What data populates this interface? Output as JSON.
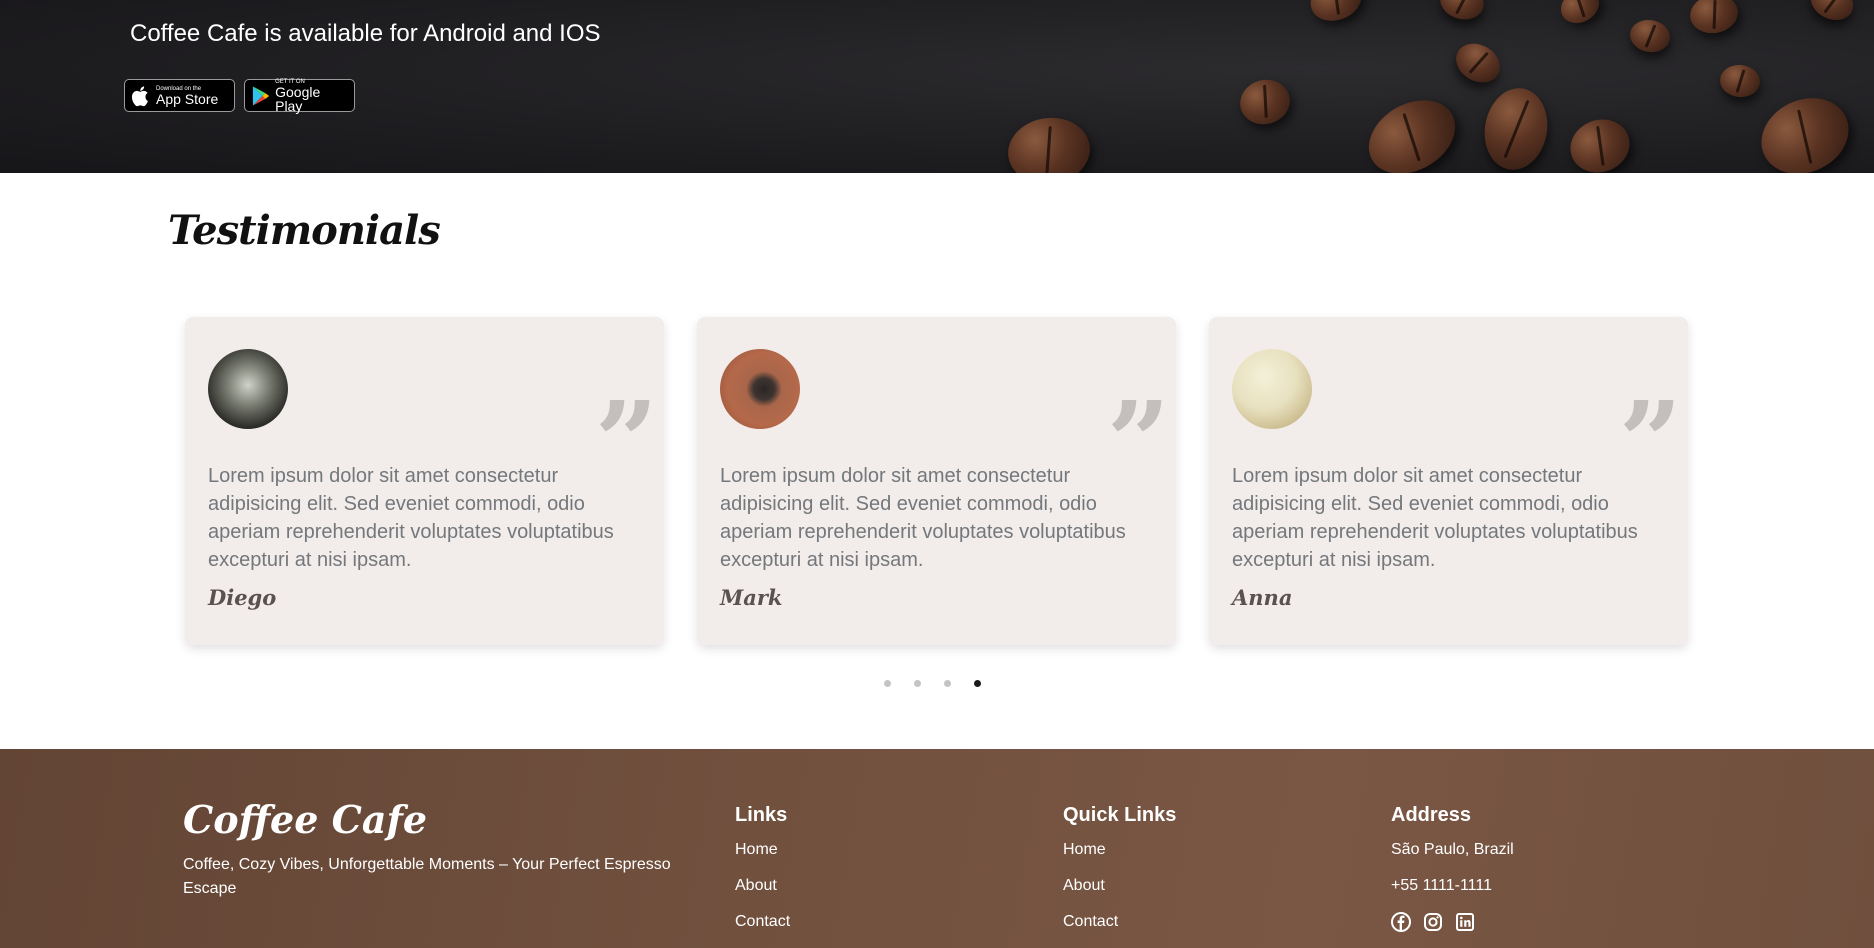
{
  "banner": {
    "title": "Coffee Cafe is available for Android and IOS",
    "app_store": {
      "small": "Download on the",
      "big": "App Store"
    },
    "google_play": {
      "small": "GET IT ON",
      "big": "Google Play"
    }
  },
  "testimonials": {
    "title": "Testimonials",
    "cards": [
      {
        "text": "Lorem ipsum dolor sit amet consectetur adipisicing elit. Sed eveniet commodi, odio aperiam reprehenderit voluptates voluptatibus excepturi at nisi ipsam.",
        "name": "Diego"
      },
      {
        "text": "Lorem ipsum dolor sit amet consectetur adipisicing elit. Sed eveniet commodi, odio aperiam reprehenderit voluptates voluptatibus excepturi at nisi ipsam.",
        "name": "Mark"
      },
      {
        "text": "Lorem ipsum dolor sit amet consectetur adipisicing elit. Sed eveniet commodi, odio aperiam reprehenderit voluptates voluptatibus excepturi at nisi ipsam.",
        "name": "Anna"
      }
    ],
    "pagination": {
      "total": 4,
      "active_index": 3
    }
  },
  "footer": {
    "brand": "Coffee Cafe",
    "tagline": "Coffee, Cozy Vibes, Unforgettable Moments – Your Perfect Espresso Escape",
    "links": {
      "heading": "Links",
      "items": [
        "Home",
        "About",
        "Contact"
      ]
    },
    "quick_links": {
      "heading": "Quick Links",
      "items": [
        "Home",
        "About",
        "Contact"
      ]
    },
    "address": {
      "heading": "Address",
      "city": "São Paulo, Brazil",
      "phone": "+55 1111-1111",
      "socials": [
        "facebook-icon",
        "instagram-icon",
        "linkedin-icon"
      ]
    }
  },
  "colors": {
    "banner_bg": "#1f1e21",
    "card_bg": "#f2ecea",
    "card_text": "#74787c",
    "footer_bg": "#71503e",
    "dot_active": "#1a1a1a",
    "dot_inactive": "#c4c4c4"
  }
}
